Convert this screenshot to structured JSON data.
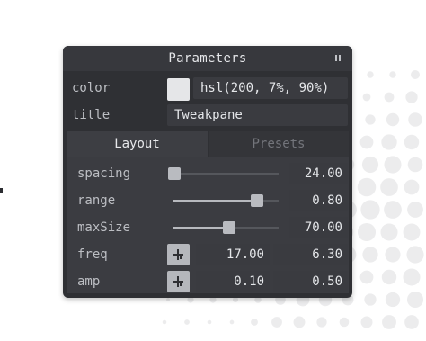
{
  "pane": {
    "title": "Parameters",
    "collapse_icon": "expand-icon"
  },
  "color": {
    "label": "color",
    "value": "hsl(200, 7%, 90%)",
    "swatch": "#e5e6e8"
  },
  "title_field": {
    "label": "title",
    "value": "Tweakpane"
  },
  "tabs": [
    {
      "label": "Layout",
      "selected": true
    },
    {
      "label": "Presets",
      "selected": false
    }
  ],
  "spacing": {
    "label": "spacing",
    "value": "24.00",
    "level": 0.0
  },
  "range": {
    "label": "range",
    "value": "0.80",
    "level": 0.8
  },
  "maxSize": {
    "label": "maxSize",
    "value": "70.00",
    "level": 0.53
  },
  "freq": {
    "label": "freq",
    "x": "17.00",
    "y": "6.30",
    "picker_icon": "point-picker-icon"
  },
  "amp": {
    "label": "amp",
    "x": "0.10",
    "y": "0.50",
    "picker_icon": "point-picker-icon"
  },
  "colors": {
    "accent": "#b9bbc0",
    "panel": "#2f3034"
  }
}
